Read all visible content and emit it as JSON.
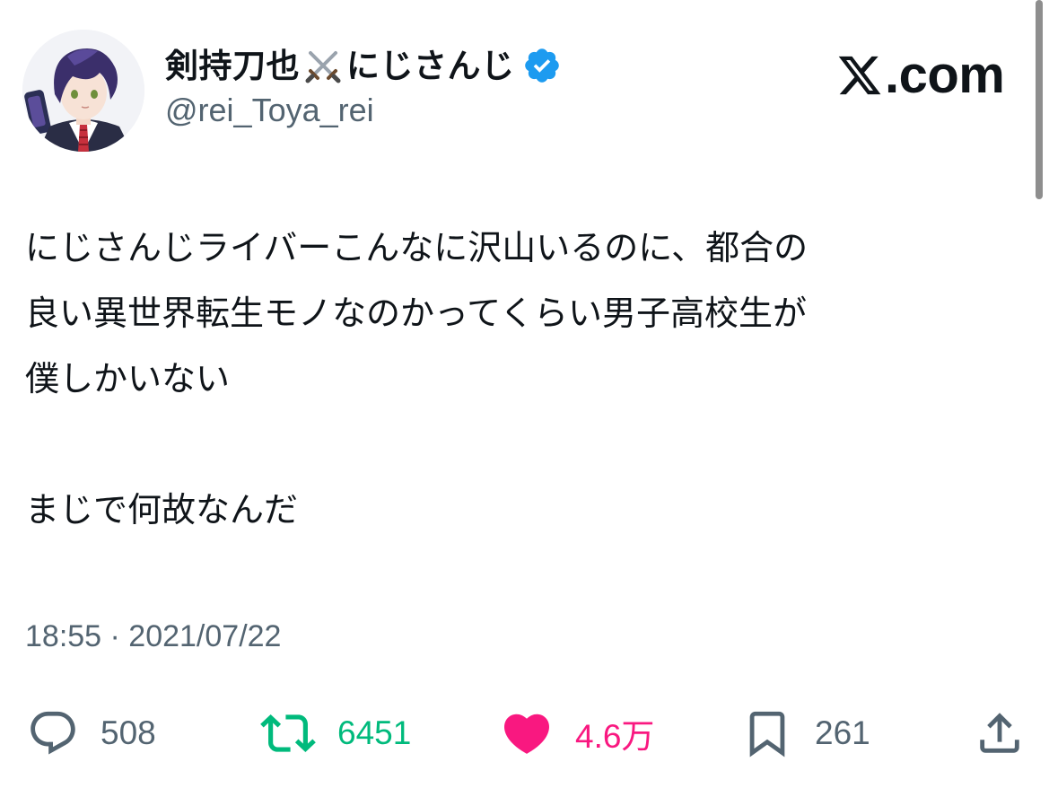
{
  "header": {
    "display_name_part1": "剣持刀也",
    "display_name_part2": "にじさんじ",
    "name_emoji": "crossed-swords-icon",
    "verified_badge": "verified-badge-icon",
    "handle": "@rei_Toya_rei",
    "brand": ".com",
    "brand_mark": "𝕏"
  },
  "tweet": {
    "paragraph1": "にじさんじライバーこんなに沢山いるのに、都合の\n良い異世界転生モノなのかってくらい男子高校生が\n僕しかいない",
    "paragraph2": "まじで何故なんだ",
    "timestamp": "18:55 · 2021/07/22"
  },
  "actions": {
    "replies": "508",
    "retweets": "6451",
    "likes": "4.6万",
    "bookmarks": "261"
  },
  "colors": {
    "text": "#0f1419",
    "secondary": "#536471",
    "retweet": "#00ba7c",
    "like": "#f91880",
    "verified": "#1d9bf0"
  }
}
